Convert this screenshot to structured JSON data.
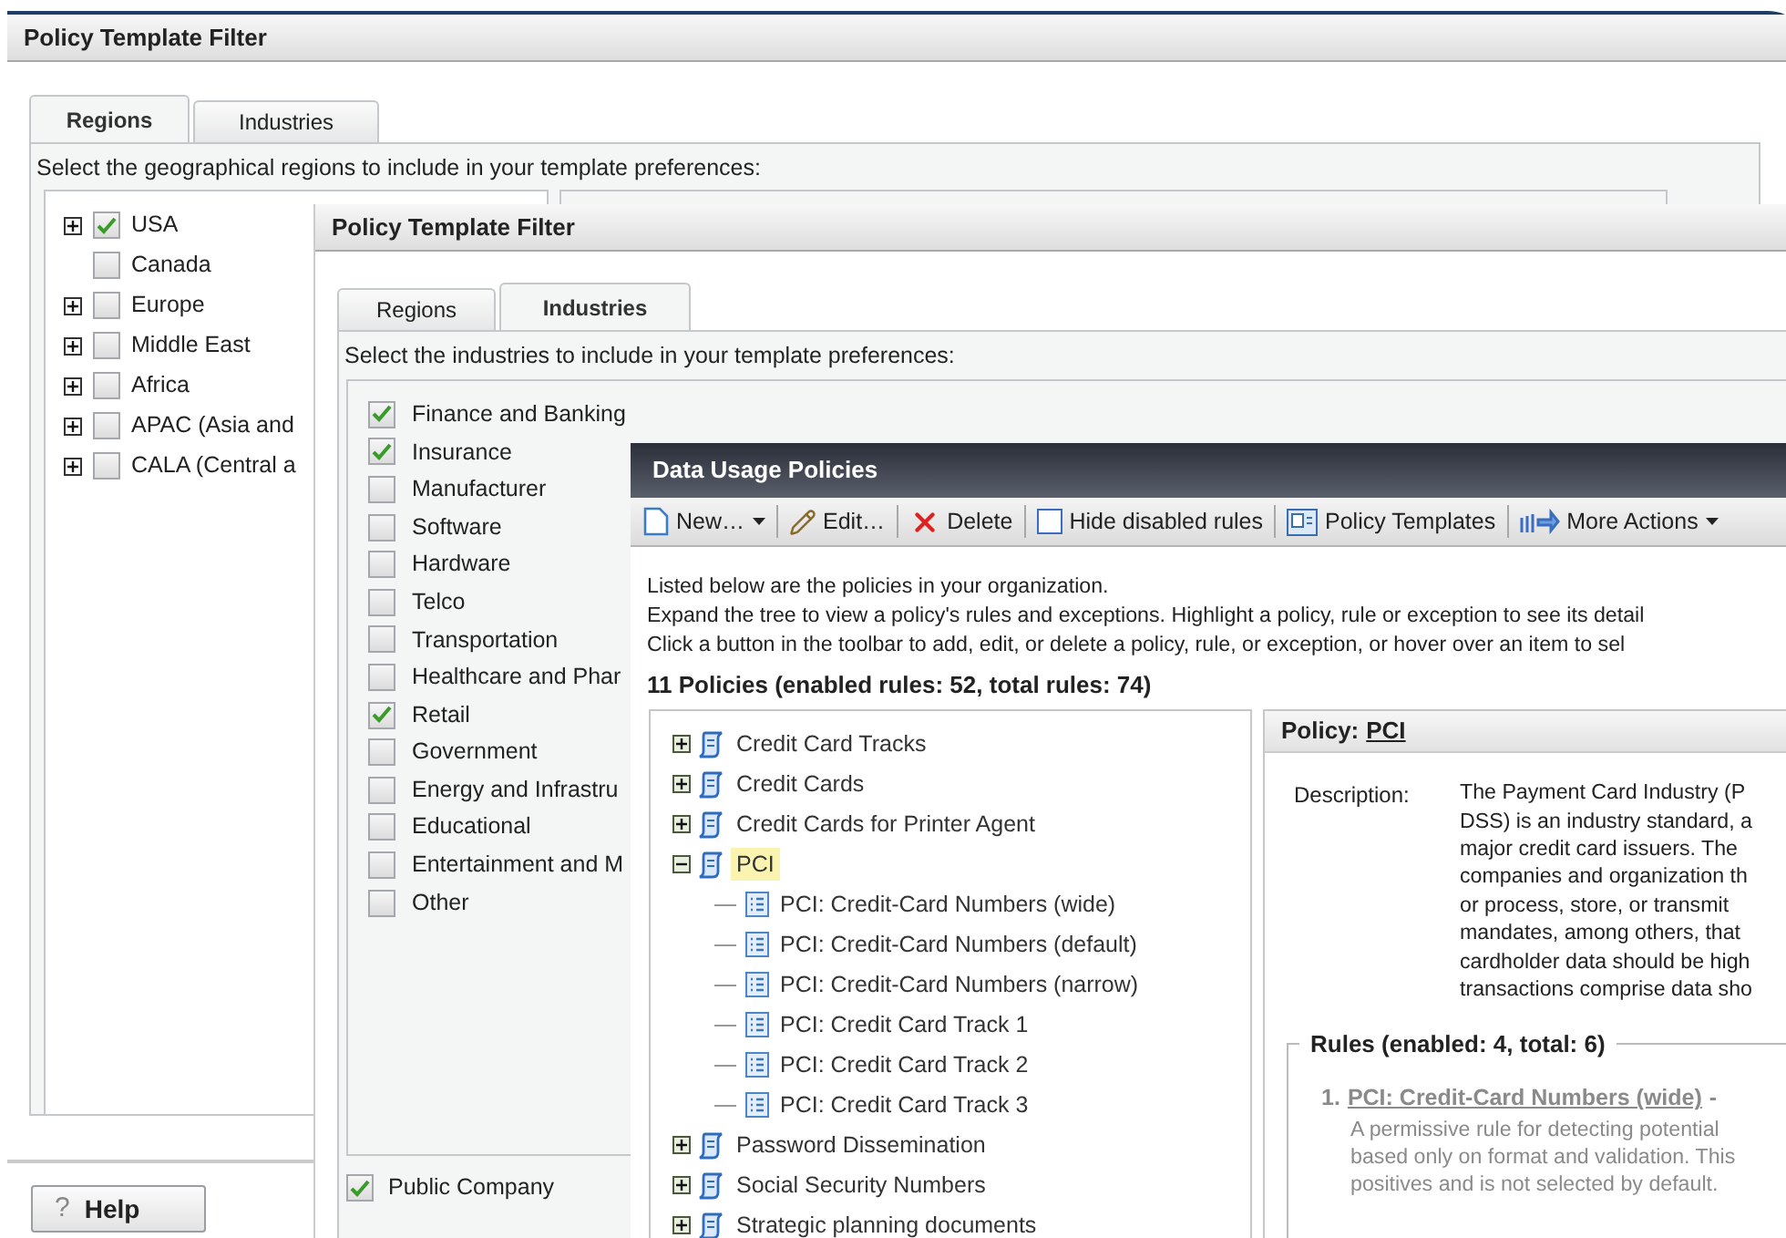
{
  "background_window": {
    "title": "Policy Template Filter",
    "tabs": [
      {
        "label": "Regions",
        "selected": true
      },
      {
        "label": "Industries",
        "selected": false
      }
    ],
    "instruction": "Select the geographical regions to include in your template preferences:",
    "regions": [
      {
        "label": "USA",
        "kind": "group",
        "checked": true
      },
      {
        "label": "Canada",
        "kind": "leaf",
        "checked": false
      },
      {
        "label": "Europe",
        "kind": "group",
        "checked": false
      },
      {
        "label": "Middle East",
        "kind": "group",
        "checked": false
      },
      {
        "label": "Africa",
        "kind": "group",
        "checked": false
      },
      {
        "label": "APAC (Asia and",
        "kind": "group",
        "checked": false
      },
      {
        "label": "CALA (Central a",
        "kind": "group",
        "checked": false
      }
    ],
    "help_button": {
      "symbol": "?",
      "label": "Help"
    }
  },
  "filter_window": {
    "title": "Policy Template Filter",
    "tabs": [
      {
        "label": "Regions",
        "selected": false
      },
      {
        "label": "Industries",
        "selected": true
      }
    ],
    "instruction": "Select the industries to include in your template preferences:",
    "industries": [
      {
        "label": "Finance and Banking",
        "checked": true
      },
      {
        "label": "Insurance",
        "checked": true
      },
      {
        "label": "Manufacturer",
        "checked": false
      },
      {
        "label": "Software",
        "checked": false
      },
      {
        "label": "Hardware",
        "checked": false
      },
      {
        "label": "Telco",
        "checked": false
      },
      {
        "label": "Transportation",
        "checked": false
      },
      {
        "label": "Healthcare and Phar",
        "checked": false
      },
      {
        "label": "Retail",
        "checked": true
      },
      {
        "label": "Government",
        "checked": false
      },
      {
        "label": "Energy and Infrastru",
        "checked": false
      },
      {
        "label": "Educational",
        "checked": false
      },
      {
        "label": "Entertainment and M",
        "checked": false
      },
      {
        "label": "Other",
        "checked": false
      }
    ],
    "public_company": {
      "label": "Public Company",
      "checked": true
    }
  },
  "policies_window": {
    "title": "Data Usage Policies",
    "toolbar": [
      {
        "label": "New…",
        "kind": "menu"
      },
      {
        "label": "Edit…",
        "kind": "button"
      },
      {
        "label": "Delete",
        "kind": "button"
      },
      {
        "label": "Hide disabled rules",
        "kind": "checkbox",
        "checked": false
      },
      {
        "label": "Policy Templates",
        "kind": "button"
      },
      {
        "label": "More Actions",
        "kind": "menu"
      }
    ],
    "intro_lines": [
      "Listed below are the policies in your organization.",
      "Expand the tree to view a policy's rules and exceptions. Highlight a policy, rule or exception to see its detail",
      "Click a button in the toolbar to add, edit, or delete a policy, rule, or exception, or hover over an item to sel"
    ],
    "summary": "11 Policies (enabled rules: 52, total rules: 74)",
    "tree": [
      {
        "label": "Credit Card Tracks",
        "expanded": false,
        "selected": false
      },
      {
        "label": "Credit Cards",
        "expanded": false,
        "selected": false
      },
      {
        "label": "Credit Cards for Printer Agent",
        "expanded": false,
        "selected": false
      },
      {
        "label": "PCI",
        "expanded": true,
        "selected": true,
        "children": [
          {
            "label": "PCI: Credit-Card Numbers (wide)",
            "selected": false
          },
          {
            "label": "PCI: Credit-Card Numbers (default)",
            "selected": false
          },
          {
            "label": "PCI: Credit-Card Numbers (narrow)",
            "selected": false
          },
          {
            "label": "PCI: Credit Card Track 1",
            "selected": false
          },
          {
            "label": "PCI: Credit Card Track 2",
            "selected": false
          },
          {
            "label": "PCI: Credit Card Track 3",
            "selected": false
          }
        ]
      },
      {
        "label": "Password Dissemination",
        "expanded": false,
        "selected": false
      },
      {
        "label": "Social Security Numbers",
        "expanded": false,
        "selected": false
      },
      {
        "label": "Strategic planning documents",
        "expanded": false,
        "selected": false
      }
    ],
    "detail": {
      "heading_label": "Policy:",
      "heading_link": "PCI",
      "description_label": "Description:",
      "description_lines": [
        "The Payment Card Industry (P",
        "DSS) is an industry standard, a",
        "major credit card issuers. The",
        "companies and organization th",
        "or process, store, or transmit",
        "mandates, among others, that",
        "cardholder data should be high",
        "transactions comprise data sho"
      ],
      "rules_heading": "Rules (enabled: 4, total: 6)",
      "rules": [
        {
          "number": "1.",
          "name": "PCI: Credit-Card Numbers (wide)",
          "separator": "-",
          "enabled": false,
          "description_lines": [
            "A permissive rule for detecting potential",
            "based only on format and validation. This",
            "positives and is not selected by default."
          ]
        }
      ]
    }
  }
}
